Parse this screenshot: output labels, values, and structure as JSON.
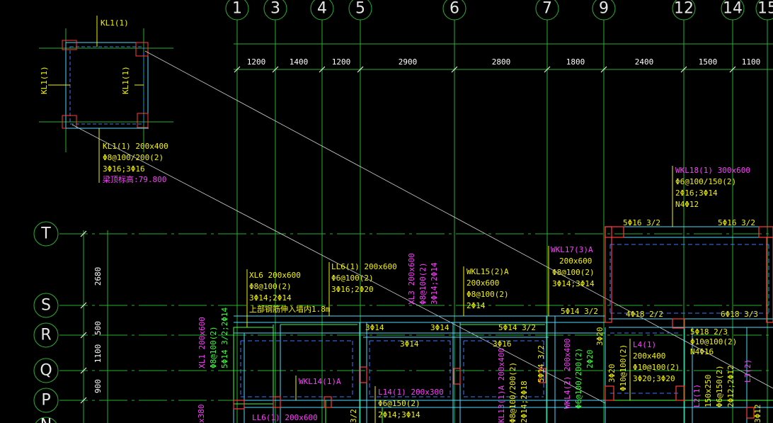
{
  "colors": {
    "background": "#000000",
    "axis": "#29b12f",
    "label": "#f2f200",
    "magenta": "#ff3cff",
    "green_text": "#3cff3c",
    "cyan": "#50d8ff",
    "column": "#ff3c3c",
    "white": "#e6e6e6",
    "dash": "#3c78ff"
  },
  "axes": {
    "columns": [
      "1",
      "3",
      "4",
      "5",
      "6",
      "7",
      "9",
      "12",
      "14",
      "15"
    ],
    "rows": [
      "T",
      "S",
      "R",
      "Q",
      "P",
      "N"
    ]
  },
  "dimensions": {
    "top": [
      "1200",
      "1400",
      "1200",
      "2900",
      "2800",
      "1800",
      "2400",
      "1500",
      "1100"
    ],
    "left": [
      "2680",
      "500",
      "1100",
      "900"
    ]
  },
  "detail": {
    "beam_top": "KL1(1)",
    "beam_left": "KL1(1)",
    "beam_right": "KL1(1)",
    "spec": [
      "KL1(1) 200x400",
      "Φ8@100/200(2)",
      "3Φ16;3Φ16"
    ],
    "elevation": "梁顶标高:79.800"
  },
  "beams": {
    "xl6": [
      "XL6 200x600",
      "Φ8@100(2)",
      "3Φ14;2Φ14",
      "上部钢筋伸入墙内1.8m"
    ],
    "ll6": [
      "LL6(1) 200x600",
      "Φ6@100(2)",
      "3Φ16;2Φ20"
    ],
    "xl3": [
      "XL3 200x600",
      "Φ8@100(2)",
      "3Φ14;2Φ14"
    ],
    "wkl15": [
      "WKL15(2)A",
      "200x600",
      "Φ8@100(2)",
      "2Φ14"
    ],
    "wkl17": [
      "WKL17(3)A",
      "200x600",
      "Φ8@100(2)",
      "3Φ14;3Φ14"
    ],
    "wkl18": [
      "WKL18(1) 300x600",
      "Φ6@100/150(2)",
      "2Φ16;3Φ14",
      "N4Φ12"
    ],
    "xl1": [
      "XL1 200x600",
      "Φ8@100(2)",
      "5Φ14 3/2;2Φ14"
    ],
    "l4": [
      "L4(1)",
      "200x400",
      "Φ10@100(2)",
      "3Φ20;3Φ20"
    ],
    "wkl14": "WKL14(1)A",
    "l14": [
      "L14(1) 200x300",
      "Φ6@150(2)",
      "2Φ14;3Φ14"
    ],
    "ll6b": "LL6(1) 200x600",
    "kl13": [
      "KL13(1)A 200x400",
      "Φ8@100/200(2)",
      "2Φ14;2Φ18"
    ],
    "wkl4": [
      "WKL4(2) 200x400",
      "Φ6@100/200(2)",
      "2Φ20"
    ],
    "l2": [
      "L2(1)",
      "150x250",
      "Φ6@150(2)",
      "2Φ12;2Φ12"
    ],
    "l3": "L3(2)",
    "col_side": [
      "3Φ20",
      "Φ10@100(2)"
    ],
    "misc_left": [
      "x380"
    ]
  },
  "rebar_notes": {
    "t_left": "5Φ16 3/2",
    "t_right": "5Φ16 3/2",
    "s_a": "5Φ14 3/2",
    "s_b": "4Φ18 2/2",
    "s_c": "6Φ18 3/3",
    "r_a": "3Φ14",
    "r_b": "3Φ14",
    "r_c": "5Φ14 3/2",
    "mid_a": "3Φ14",
    "mid_b": "3Φ16",
    "right_a": [
      "5Φ18 2/3",
      "Φ10@100(2)",
      "N4Φ16"
    ],
    "v_a": "3Φ20",
    "v_b": "5Φ14 3/2",
    "v_c": "3Φ12",
    "v_d": "3/2"
  }
}
